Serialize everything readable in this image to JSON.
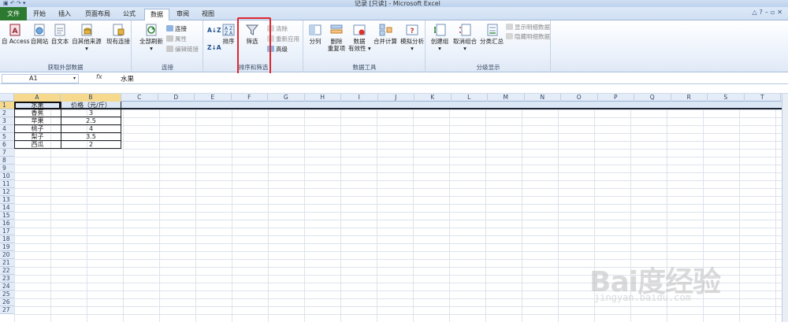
{
  "window": {
    "title": "记录 [只读] - Microsoft Excel"
  },
  "colors": {
    "file_tab": "#2b7a2f",
    "highlight": "#e0262c",
    "selected_header": "#f6d98c"
  },
  "tabs": [
    {
      "label": "文件"
    },
    {
      "label": "开始"
    },
    {
      "label": "插入"
    },
    {
      "label": "页面布局"
    },
    {
      "label": "公式"
    },
    {
      "label": "数据"
    },
    {
      "label": "审阅"
    },
    {
      "label": "视图"
    }
  ],
  "ribbon": {
    "external": {
      "label": "获取外部数据",
      "access": "自 Access",
      "web": "自网站",
      "text": "自文本",
      "other1": "自其他来源",
      "other2": "▾",
      "existing": "现有连接"
    },
    "connections": {
      "label": "连接",
      "refresh1": "全部刷新",
      "refresh2": "▾",
      "conn": "连接",
      "props": "属性",
      "editlinks": "编辑链接"
    },
    "sort": {
      "label": "排序和筛选",
      "az": "A↓Z",
      "za": "Z↓A",
      "sort": "排序",
      "filter": "筛选",
      "clear": "清除",
      "reapply": "重新应用",
      "advanced": "高级"
    },
    "tools": {
      "label": "数据工具",
      "split": "分列",
      "dup1": "删除",
      "dup2": "重复项",
      "valid1": "数据",
      "valid2": "有效性 ▾",
      "consolidate": "合并计算",
      "whatif1": "模拟分析",
      "whatif2": "▾"
    },
    "outline": {
      "label": "分级显示",
      "group1": "创建组",
      "group2": "▾",
      "ungroup1": "取消组合",
      "ungroup2": "▾",
      "subtotal": "分类汇总",
      "show": "显示明细数据",
      "hide": "隐藏明细数据"
    }
  },
  "formula": {
    "namebox": "A1",
    "fx": "fx",
    "content": "水果"
  },
  "sheet": {
    "columns": [
      "A",
      "B",
      "C",
      "D",
      "E",
      "F",
      "G",
      "H",
      "I",
      "J",
      "K",
      "L",
      "M",
      "N",
      "O",
      "P",
      "Q",
      "R",
      "S",
      "T"
    ],
    "rows": [
      "1",
      "2",
      "3",
      "4",
      "5",
      "6",
      "7",
      "8",
      "9",
      "10",
      "11",
      "12",
      "13",
      "14",
      "15",
      "16",
      "17",
      "18",
      "19",
      "20",
      "21",
      "22",
      "23",
      "24",
      "25",
      "26",
      "27"
    ],
    "table": [
      [
        "水果",
        "价格（元/斤）"
      ],
      [
        "香蕉",
        "3"
      ],
      [
        "苹果",
        "2.5"
      ],
      [
        "桃子",
        "4"
      ],
      [
        "梨子",
        "3.5"
      ],
      [
        "西瓜",
        "2"
      ]
    ]
  },
  "watermark": {
    "main": "Bai度经验",
    "sub": "jingyan.baidu.com"
  }
}
